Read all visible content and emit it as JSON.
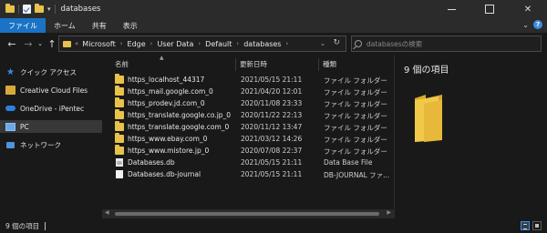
{
  "window": {
    "title": "databases"
  },
  "ribbon": {
    "tabs": [
      "ファイル",
      "ホーム",
      "共有",
      "表示"
    ]
  },
  "address": {
    "breadcrumb": [
      "Microsoft",
      "Edge",
      "User Data",
      "Default",
      "databases"
    ],
    "search_placeholder": "databasesの検索"
  },
  "sidebar": {
    "items": [
      {
        "label": "クイック アクセス",
        "icon": "star-icon"
      },
      {
        "label": "Creative Cloud Files",
        "icon": "creative-cloud-icon"
      },
      {
        "label": "OneDrive - iPentec",
        "icon": "cloud-icon"
      },
      {
        "label": "PC",
        "icon": "pc-icon"
      },
      {
        "label": "ネットワーク",
        "icon": "network-icon"
      }
    ],
    "selected": "PC"
  },
  "columns": {
    "name": "名前",
    "date": "更新日時",
    "type": "種類"
  },
  "files": [
    {
      "name": "https_localhost_44317",
      "date": "2021/05/15 21:11",
      "type": "ファイル フォルダー",
      "icon": "folder-icon"
    },
    {
      "name": "https_mail.google.com_0",
      "date": "2021/04/20 12:01",
      "type": "ファイル フォルダー",
      "icon": "folder-icon"
    },
    {
      "name": "https_prodev.jd.com_0",
      "date": "2020/11/08 23:33",
      "type": "ファイル フォルダー",
      "icon": "folder-icon"
    },
    {
      "name": "https_translate.google.co.jp_0",
      "date": "2020/11/22 22:13",
      "type": "ファイル フォルダー",
      "icon": "folder-icon"
    },
    {
      "name": "https_translate.google.com_0",
      "date": "2020/11/12 13:47",
      "type": "ファイル フォルダー",
      "icon": "folder-icon"
    },
    {
      "name": "https_www.ebay.com_0",
      "date": "2021/03/12 14:26",
      "type": "ファイル フォルダー",
      "icon": "folder-icon"
    },
    {
      "name": "https_www.mistore.jp_0",
      "date": "2020/07/08 22:37",
      "type": "ファイル フォルダー",
      "icon": "folder-icon"
    },
    {
      "name": "Databases.db",
      "date": "2021/05/15 21:11",
      "type": "Data Base File",
      "icon": "database-file-icon"
    },
    {
      "name": "Databases.db-journal",
      "date": "2021/05/15 21:11",
      "type": "DB-JOURNAL ファ...",
      "icon": "file-icon"
    }
  ],
  "preview": {
    "count_text": "9 個の項目"
  },
  "status": {
    "text": "9 個の項目"
  },
  "colors": {
    "accent": "#1a73c6",
    "folder": "#e8c24a",
    "background": "#191919"
  }
}
